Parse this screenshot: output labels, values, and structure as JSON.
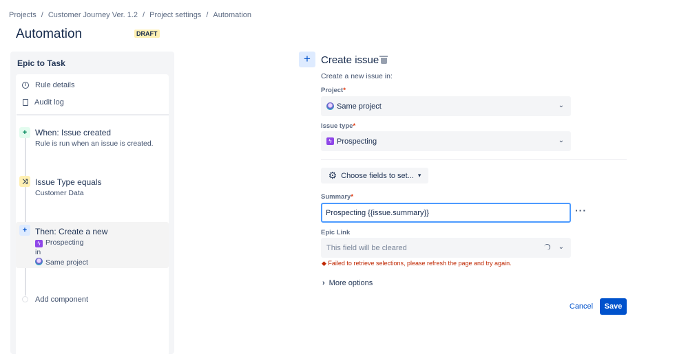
{
  "breadcrumb": [
    "Projects",
    "Customer Journey Ver. 1.2",
    "Project settings",
    "Automation"
  ],
  "page_title": "Automation",
  "status_badge": "DRAFT",
  "rule": {
    "name": "Epic to Task",
    "nav": [
      {
        "label": "Rule details",
        "icon": "info-icon"
      },
      {
        "label": "Audit log",
        "icon": "document-icon"
      }
    ],
    "trigger": {
      "title": "When: Issue created",
      "subtitle": "Rule is run when an issue is created."
    },
    "condition": {
      "title": "Issue Type equals",
      "subtitle": "Customer Data"
    },
    "action": {
      "title": "Then: Create a new",
      "issue_type": "Prospecting",
      "connector": "in",
      "project": "Same project"
    },
    "add_component": "Add component"
  },
  "editor": {
    "title": "Create issue",
    "subtitle": "Create a new issue in:",
    "project_label": "Project",
    "project_value": "Same project",
    "issue_type_label": "Issue type",
    "issue_type_value": "Prospecting",
    "required_mark": "*",
    "choose_fields": "Choose fields to set...",
    "summary_label": "Summary",
    "summary_value": "Prospecting {{issue.summary}}",
    "epic_link_label": "Epic Link",
    "epic_link_placeholder": "This field will be cleared",
    "error": "Failed to retrieve selections, please refresh the page and try again.",
    "more_options": "More options",
    "cancel": "Cancel",
    "save": "Save"
  },
  "colors": {
    "primary": "#0052cc",
    "error": "#bf2600",
    "badge": "#fff0b3",
    "issue_type": "#8f47e8"
  }
}
